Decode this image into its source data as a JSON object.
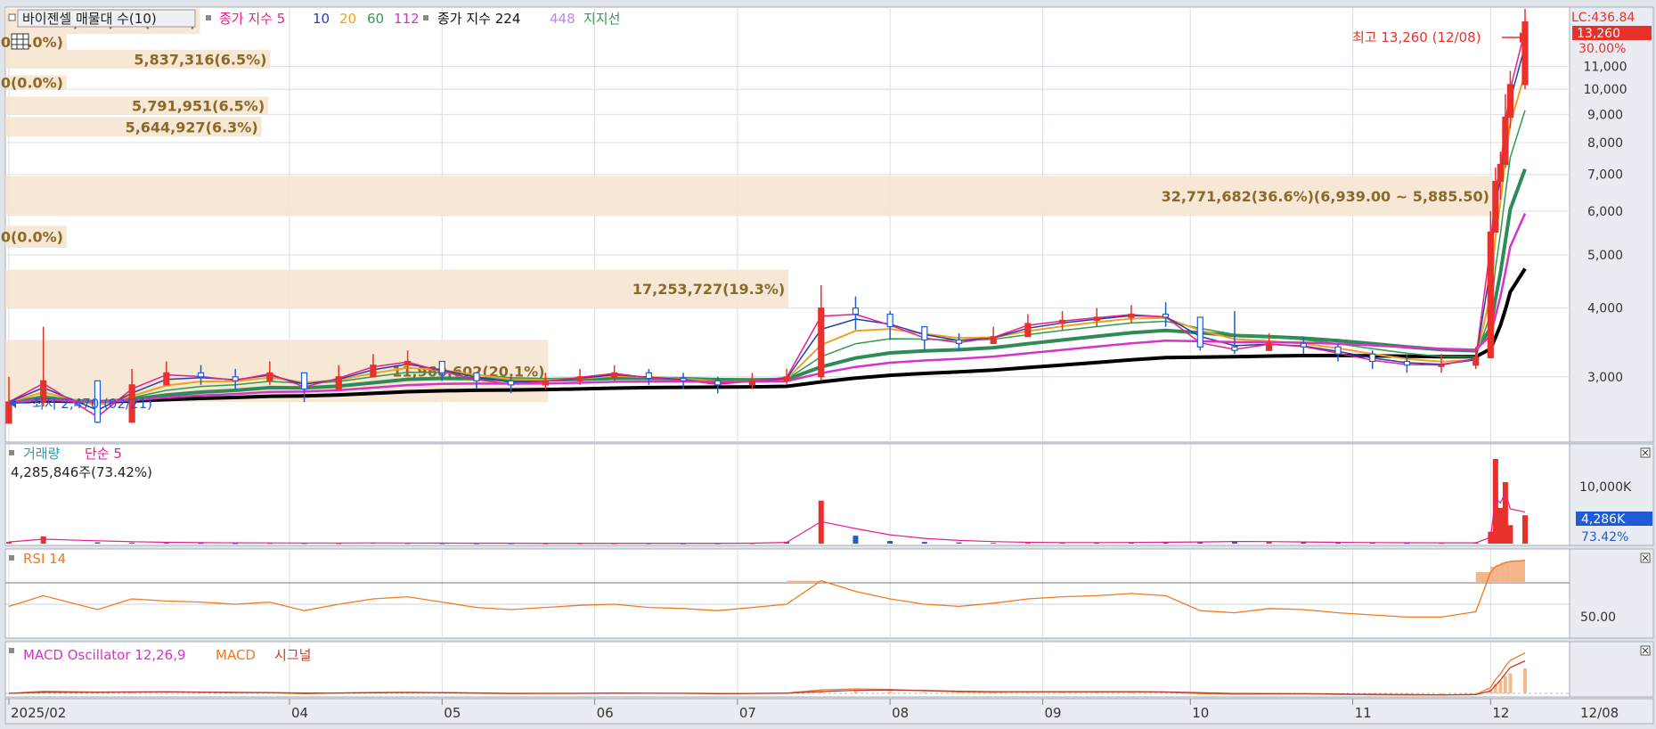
{
  "colors": {
    "up": "#e8312a",
    "down": "#1f5bd6",
    "ma5": "#e91e8c",
    "ma10": "#1f3fae",
    "ma20": "#f0a020",
    "ma60": "#2e9c4e",
    "ma112": "#d633c8",
    "ma224": "#000000",
    "ma448": "#b98ae6",
    "support": "#2e8b57",
    "rsi": "#f07a20",
    "macd": "#f07a20",
    "signal": "#c0392b",
    "profile_fill": "#f5e6d0",
    "profile_text": "#8a6a2a"
  },
  "legend": {
    "profile_label": "바이젠셀 매물대 수(10)",
    "ma_group_label": "종가 지수 5",
    "ma_10": "10",
    "ma_20": "20",
    "ma_60": "60",
    "ma_112": "112",
    "ma_group2_label": "종가 지수 224",
    "ma_448": "448",
    "support_label": "지지선"
  },
  "price_panel": {
    "lc_label": "LC:436.84",
    "current_price": "13,260",
    "pct_label": "30.00%",
    "high_label": "최고 13,260 (12/08)",
    "low_label": "최저 2,470 (02/21)",
    "y_ticks": [
      "11,000",
      "10,000",
      "9,000",
      "8,000",
      "7,000",
      "6,000",
      "5,000",
      "4,000",
      "3,000"
    ]
  },
  "volume_profile": [
    {
      "label": "4,285,846(4.8%)",
      "price_hi": 14000,
      "price_lo": 12600,
      "volume": 4285846
    },
    {
      "label": "0(0.0%)",
      "price_hi": 12600,
      "price_lo": 11800,
      "volume": 0
    },
    {
      "label": "5,837,316(6.5%)",
      "price_hi": 11800,
      "price_lo": 10900,
      "volume": 5837316
    },
    {
      "label": "0(0.0%)",
      "price_hi": 10600,
      "price_lo": 10000,
      "volume": 0
    },
    {
      "label": "5,791,951(6.5%)",
      "price_hi": 9700,
      "price_lo": 9000,
      "volume": 5791951
    },
    {
      "label": "5,644,927(6.3%)",
      "price_hi": 8900,
      "price_lo": 8200,
      "volume": 5644927
    },
    {
      "label": "32,771,682(36.6%)(6,939.00 ~ 5,885.50)",
      "price_hi": 6950,
      "price_lo": 5880,
      "volume": 32771682
    },
    {
      "label": "0(0.0%)",
      "price_hi": 5650,
      "price_lo": 5150,
      "volume": 0
    },
    {
      "label": "17,253,727(19.3%)",
      "price_hi": 4700,
      "price_lo": 4000,
      "volume": 17253727
    },
    {
      "label": "11,960,602(20.1%)",
      "price_hi": 3500,
      "price_lo": 2700,
      "volume": 11960602
    }
  ],
  "volume_panel": {
    "title": "거래량",
    "ma_label": "단순 5",
    "info": "4,285,846주(73.42%)",
    "y_tick": "10,000K",
    "current_label": "4,286K",
    "pct_label": "73.42%"
  },
  "rsi_panel": {
    "title": "RSI 14",
    "y_tick": "50.00"
  },
  "macd_panel": {
    "title": "MACD Oscillator 12,26,9",
    "macd_label": "MACD",
    "signal_label": "시그널"
  },
  "x_axis": {
    "labels": [
      "2025/02",
      "04",
      "05",
      "06",
      "07",
      "08",
      "09",
      "10",
      "11",
      "12"
    ],
    "label_dates": [
      "2025-02-03",
      "2025-04-01",
      "2025-05-02",
      "2025-06-02",
      "2025-07-01",
      "2025-08-01",
      "2025-09-01",
      "2025-10-01",
      "2025-11-03",
      "2025-12-01"
    ],
    "right_label": "12/08"
  },
  "chart_data": {
    "type": "candlestick",
    "y_scale": "log",
    "ylim": [
      2300,
      14000
    ],
    "dates": [
      "2025-02-03",
      "2025-02-10",
      "2025-02-21",
      "2025-02-28",
      "2025-03-07",
      "2025-03-14",
      "2025-03-21",
      "2025-03-28",
      "2025-04-04",
      "2025-04-11",
      "2025-04-18",
      "2025-04-25",
      "2025-05-02",
      "2025-05-09",
      "2025-05-16",
      "2025-05-23",
      "2025-05-30",
      "2025-06-06",
      "2025-06-13",
      "2025-06-20",
      "2025-06-27",
      "2025-07-04",
      "2025-07-11",
      "2025-07-18",
      "2025-07-25",
      "2025-08-01",
      "2025-08-08",
      "2025-08-15",
      "2025-08-22",
      "2025-08-29",
      "2025-09-05",
      "2025-09-12",
      "2025-09-19",
      "2025-09-26",
      "2025-10-03",
      "2025-10-10",
      "2025-10-17",
      "2025-10-24",
      "2025-10-31",
      "2025-11-07",
      "2025-11-14",
      "2025-11-21",
      "2025-11-28",
      "2025-12-01",
      "2025-12-02",
      "2025-12-03",
      "2025-12-04",
      "2025-12-05",
      "2025-12-08"
    ],
    "close": [
      2700,
      2950,
      2480,
      2900,
      3050,
      3000,
      2950,
      3050,
      2850,
      3000,
      3150,
      3200,
      3050,
      2950,
      2900,
      2950,
      3000,
      3050,
      2980,
      2950,
      2900,
      2950,
      3000,
      4000,
      3900,
      3700,
      3500,
      3450,
      3550,
      3750,
      3800,
      3850,
      3900,
      3850,
      3400,
      3350,
      3450,
      3400,
      3300,
      3200,
      3150,
      3150,
      3250,
      5500,
      6800,
      7300,
      8900,
      10200,
      13260
    ],
    "high": [
      3000,
      3700,
      2900,
      3100,
      3200,
      3150,
      3100,
      3200,
      3000,
      3150,
      3300,
      3350,
      3200,
      3050,
      3000,
      3050,
      3100,
      3150,
      3100,
      3050,
      3000,
      3050,
      3100,
      4400,
      4200,
      3950,
      3700,
      3600,
      3700,
      3900,
      3950,
      4000,
      4050,
      4100,
      3550,
      3950,
      3600,
      3550,
      3450,
      3350,
      3300,
      3300,
      3400,
      6000,
      7200,
      7700,
      9800,
      10800,
      14000
    ],
    "low": [
      2470,
      2650,
      2470,
      2800,
      2950,
      2900,
      2850,
      2900,
      2700,
      2850,
      3000,
      3050,
      2950,
      2850,
      2800,
      2850,
      2900,
      2950,
      2900,
      2850,
      2800,
      2850,
      2900,
      2950,
      3650,
      3500,
      3350,
      3350,
      3450,
      3550,
      3650,
      3700,
      3750,
      3700,
      3350,
      3300,
      3350,
      3300,
      3200,
      3100,
      3050,
      3050,
      3100,
      3400,
      5600,
      6300,
      7200,
      8500,
      10000
    ],
    "volume_k": [
      250,
      1100,
      200,
      150,
      120,
      100,
      80,
      100,
      90,
      80,
      120,
      90,
      70,
      60,
      60,
      50,
      60,
      60,
      60,
      50,
      60,
      80,
      300,
      6500,
      1200,
      400,
      250,
      180,
      120,
      100,
      120,
      150,
      200,
      250,
      300,
      400,
      300,
      200,
      150,
      120,
      100,
      110,
      120,
      1800,
      12800,
      5400,
      9300,
      2800,
      4286
    ],
    "rsi": [
      48,
      58,
      45,
      55,
      53,
      52,
      50,
      52,
      44,
      50,
      55,
      57,
      52,
      47,
      45,
      47,
      49,
      50,
      47,
      46,
      44,
      47,
      50,
      72,
      62,
      55,
      50,
      48,
      51,
      55,
      57,
      58,
      60,
      58,
      44,
      42,
      46,
      45,
      42,
      40,
      38,
      38,
      43,
      80,
      85,
      87,
      89,
      90,
      91
    ],
    "rsi_ylim": [
      20,
      100
    ],
    "rsi_ref": 70,
    "macd_osc": [
      0,
      0.5,
      0.2,
      0.3,
      0.3,
      0.2,
      0.1,
      0.1,
      -0.1,
      0.1,
      0.2,
      0.2,
      0.1,
      0,
      -0.1,
      0,
      0,
      0.1,
      0,
      0,
      -0.1,
      0,
      0.1,
      0.8,
      0.9,
      0.7,
      0.4,
      0.2,
      0.2,
      0.3,
      0.3,
      0.3,
      0.3,
      0.2,
      -0.1,
      -0.2,
      -0.1,
      -0.1,
      -0.2,
      -0.3,
      -0.3,
      -0.3,
      -0.2,
      1.5,
      3,
      4,
      5.5,
      6.5,
      8
    ]
  }
}
